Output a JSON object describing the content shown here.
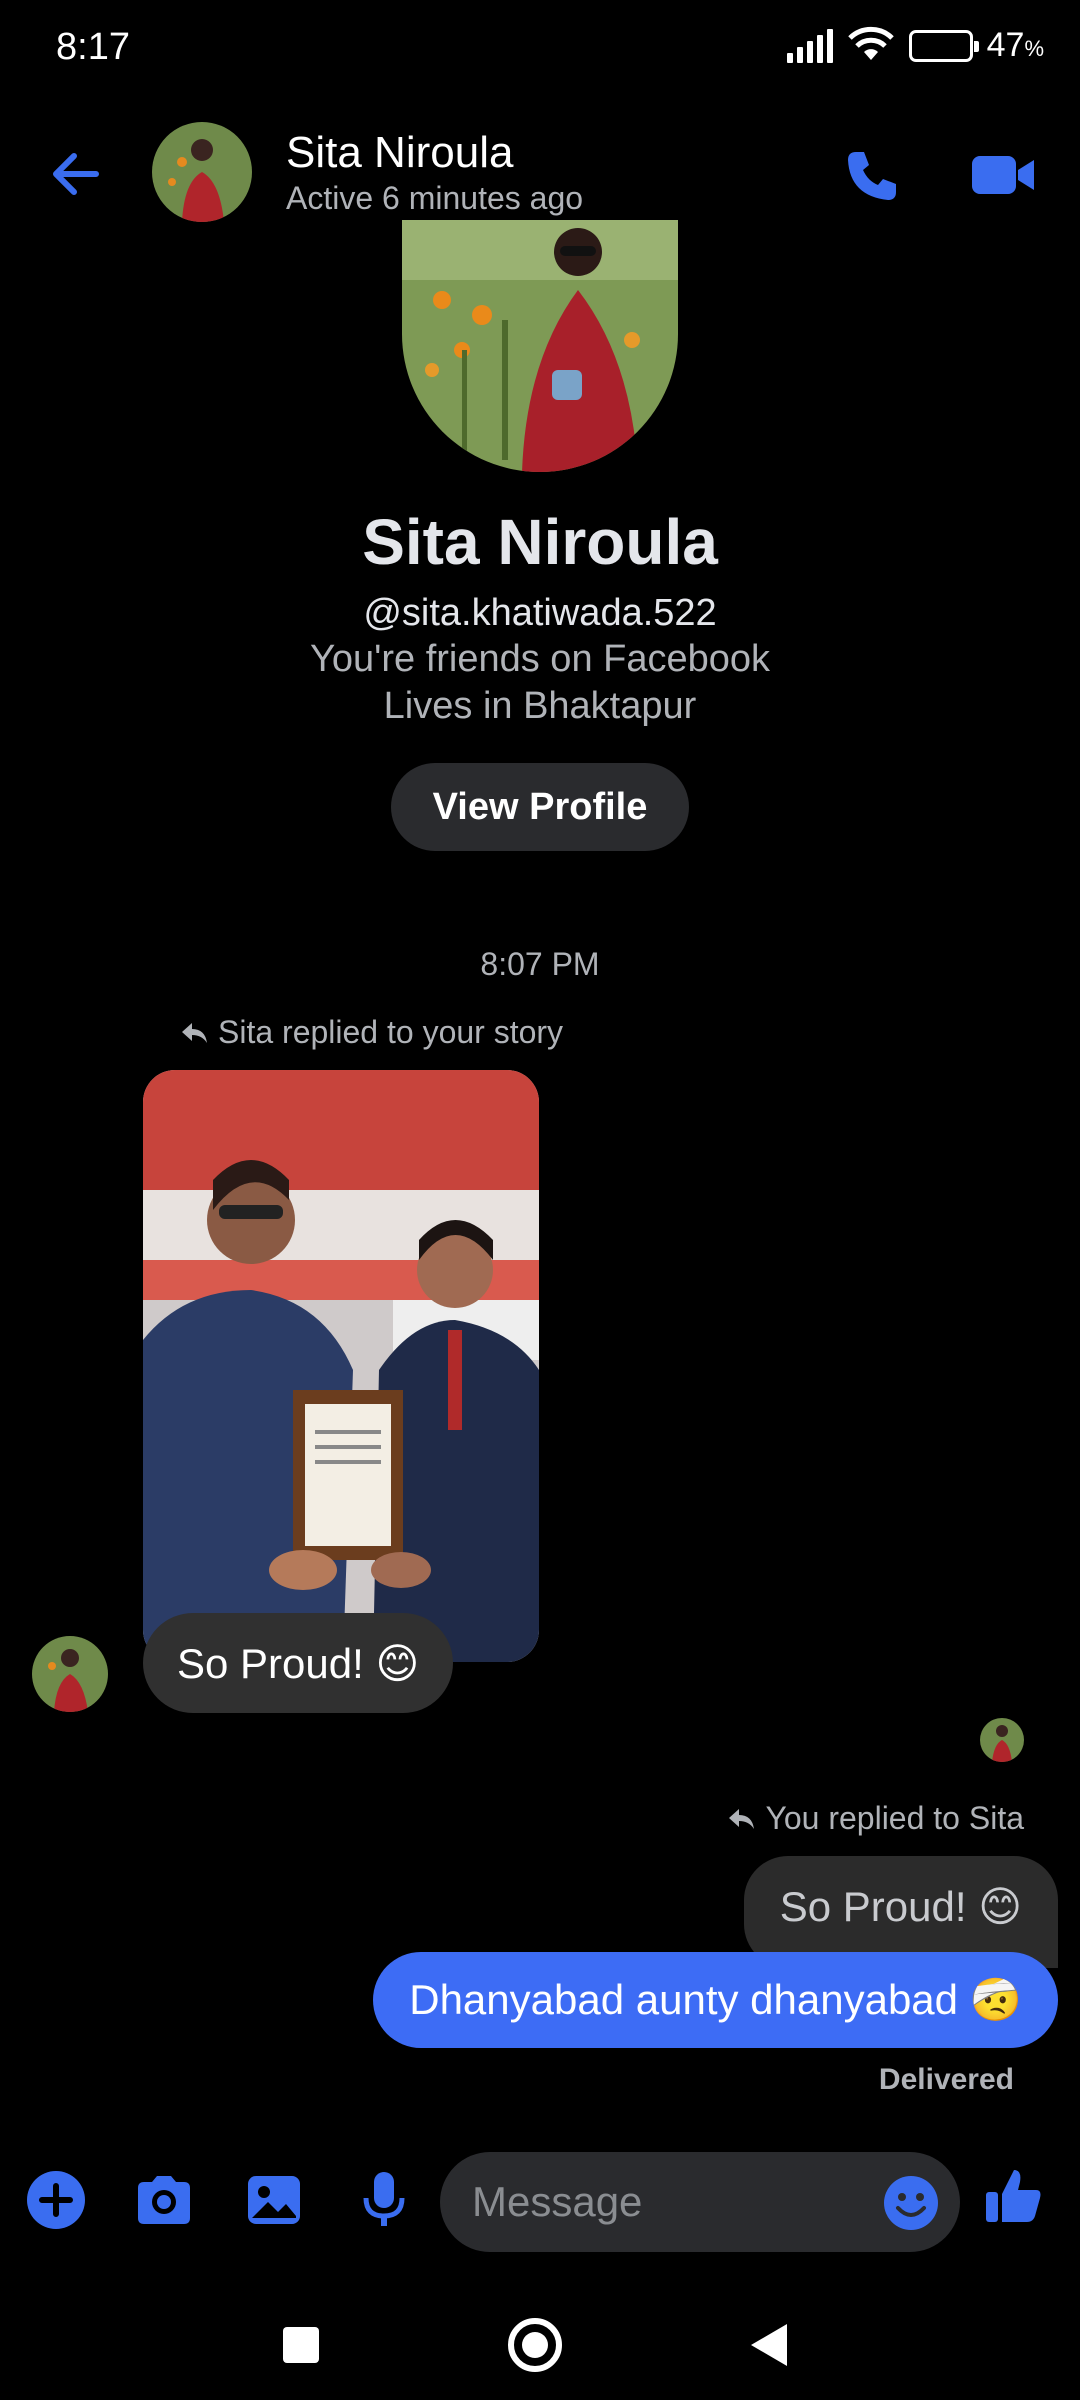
{
  "status_bar": {
    "time": "8:17",
    "battery_percent": "47",
    "battery_unit": "%",
    "battery_level": 0.47,
    "icons": [
      "signal-icon",
      "wifi-icon",
      "battery-icon"
    ]
  },
  "header": {
    "contact_name": "Sita Niroula",
    "active_status": "Active 6 minutes ago",
    "icons": [
      "back-arrow-icon",
      "phone-call-icon",
      "video-call-icon"
    ]
  },
  "profile": {
    "name": "Sita Niroula",
    "handle": "@sita.khatiwada.522",
    "friends_text": "You're friends on Facebook",
    "lives_text": "Lives in Bhaktapur",
    "view_profile_label": "View Profile"
  },
  "conversation": {
    "timestamp": "8:07 PM",
    "story_reply_note": "Sita replied to your story",
    "incoming_message": "So Proud! 😊",
    "your_reply_note": "You replied to Sita",
    "quoted_message": "So Proud! 😊",
    "outgoing_message": "Dhanyabad aunty dhanyabad 🤕",
    "delivery_status": "Delivered"
  },
  "composer": {
    "placeholder": "Message",
    "icons": [
      "plus-icon",
      "camera-icon",
      "gallery-icon",
      "microphone-icon",
      "emoji-icon",
      "thumbs-up-icon"
    ]
  },
  "navigation": {
    "icons": [
      "recent-apps-icon",
      "home-icon",
      "back-icon"
    ]
  },
  "colors": {
    "accent": "#3a6df0",
    "background": "#000000",
    "bubble_incoming": "#303030",
    "bubble_outgoing": "#3d6cf5",
    "battery_fill": "#f5b33b"
  }
}
